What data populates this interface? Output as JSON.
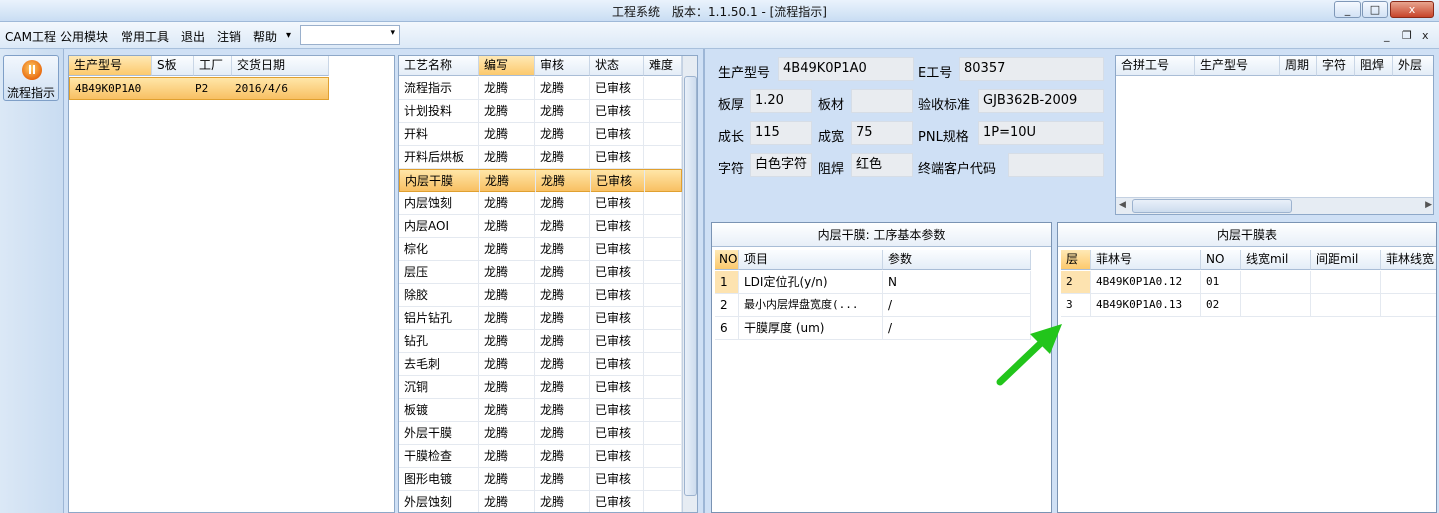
{
  "window": {
    "title": "工程系统　版本：1.1.50.1 - [流程指示]",
    "controls": [
      "_",
      "□",
      "x"
    ]
  },
  "menu": {
    "items": [
      "CAM工程",
      "公用模块",
      "常用工具",
      "退出",
      "注销",
      "帮助"
    ],
    "dropdown_arrow": "▾",
    "combo_value": "",
    "mdi_controls": [
      "_",
      "❐",
      "x"
    ]
  },
  "nav": {
    "label": "流程指示",
    "icon": "flow-icon"
  },
  "orders": {
    "columns": [
      "生产型号",
      "S板",
      "工厂",
      "交货日期"
    ],
    "rows": [
      [
        "4B49K0P1A0",
        "",
        "P2",
        "2016/4/6"
      ]
    ]
  },
  "process": {
    "columns": [
      "工艺名称",
      "编写",
      "审核",
      "状态",
      "难度"
    ],
    "selected_index": 4,
    "rows": [
      [
        "流程指示",
        "龙腾",
        "龙腾",
        "已审核",
        ""
      ],
      [
        "计划投料",
        "龙腾",
        "龙腾",
        "已审核",
        ""
      ],
      [
        "开料",
        "龙腾",
        "龙腾",
        "已审核",
        ""
      ],
      [
        "开料后烘板",
        "龙腾",
        "龙腾",
        "已审核",
        ""
      ],
      [
        "内层干膜",
        "龙腾",
        "龙腾",
        "已审核",
        ""
      ],
      [
        "内层蚀刻",
        "龙腾",
        "龙腾",
        "已审核",
        ""
      ],
      [
        "内层AOI",
        "龙腾",
        "龙腾",
        "已审核",
        ""
      ],
      [
        "棕化",
        "龙腾",
        "龙腾",
        "已审核",
        ""
      ],
      [
        "层压",
        "龙腾",
        "龙腾",
        "已审核",
        ""
      ],
      [
        "除胶",
        "龙腾",
        "龙腾",
        "已审核",
        ""
      ],
      [
        "铝片钻孔",
        "龙腾",
        "龙腾",
        "已审核",
        ""
      ],
      [
        "钻孔",
        "龙腾",
        "龙腾",
        "已审核",
        ""
      ],
      [
        "去毛刺",
        "龙腾",
        "龙腾",
        "已审核",
        ""
      ],
      [
        "沉铜",
        "龙腾",
        "龙腾",
        "已审核",
        ""
      ],
      [
        "板镀",
        "龙腾",
        "龙腾",
        "已审核",
        ""
      ],
      [
        "外层干膜",
        "龙腾",
        "龙腾",
        "已审核",
        ""
      ],
      [
        "干膜检查",
        "龙腾",
        "龙腾",
        "已审核",
        ""
      ],
      [
        "图形电镀",
        "龙腾",
        "龙腾",
        "已审核",
        ""
      ],
      [
        "外层蚀刻",
        "龙腾",
        "龙腾",
        "已审核",
        ""
      ]
    ]
  },
  "info": {
    "model_label": "生产型号",
    "model_value": "4B49K0P1A0",
    "eno_label": "E工号",
    "eno_value": "80357",
    "thickness_label": "板厚",
    "thickness_value": "1.20",
    "material_label": "板材",
    "material_value": "",
    "standard_label": "验收标准",
    "standard_value": "GJB362B-2009",
    "length_label": "成长",
    "length_value": "115",
    "width_label": "成宽",
    "width_value": "75",
    "pnl_label": "PNL规格",
    "pnl_value": "1P=10U",
    "char_label": "字符",
    "char_value": "白色字符",
    "mask_label": "阻焊",
    "mask_value": "红色",
    "customer_label": "终端客户代码",
    "customer_value": ""
  },
  "combine": {
    "columns": [
      "合拼工号",
      "生产型号",
      "周期",
      "字符",
      "阻焊",
      "外层"
    ],
    "rows": []
  },
  "params": {
    "title": "内层干膜: 工序基本参数",
    "columns": [
      "NO",
      "项目",
      "参数"
    ],
    "rows": [
      [
        "1",
        "LDI定位孔(y/n)",
        "N"
      ],
      [
        "2",
        "最小内层焊盘宽度(...",
        "/"
      ],
      [
        "6",
        "干膜厚度 (um)",
        "/"
      ]
    ]
  },
  "film": {
    "title": "内层干膜表",
    "columns": [
      "层",
      "菲林号",
      "NO",
      "线宽mil",
      "间距mil",
      "菲林线宽"
    ],
    "rows": [
      [
        "2",
        "4B49K0P1A0.12",
        "01",
        "",
        "",
        ""
      ],
      [
        "3",
        "4B49K0P1A0.13",
        "02",
        "",
        "",
        ""
      ]
    ]
  },
  "colors": {
    "accent": "#f8c063",
    "arrow": "#22c51b",
    "background": "#cfe0f5"
  }
}
